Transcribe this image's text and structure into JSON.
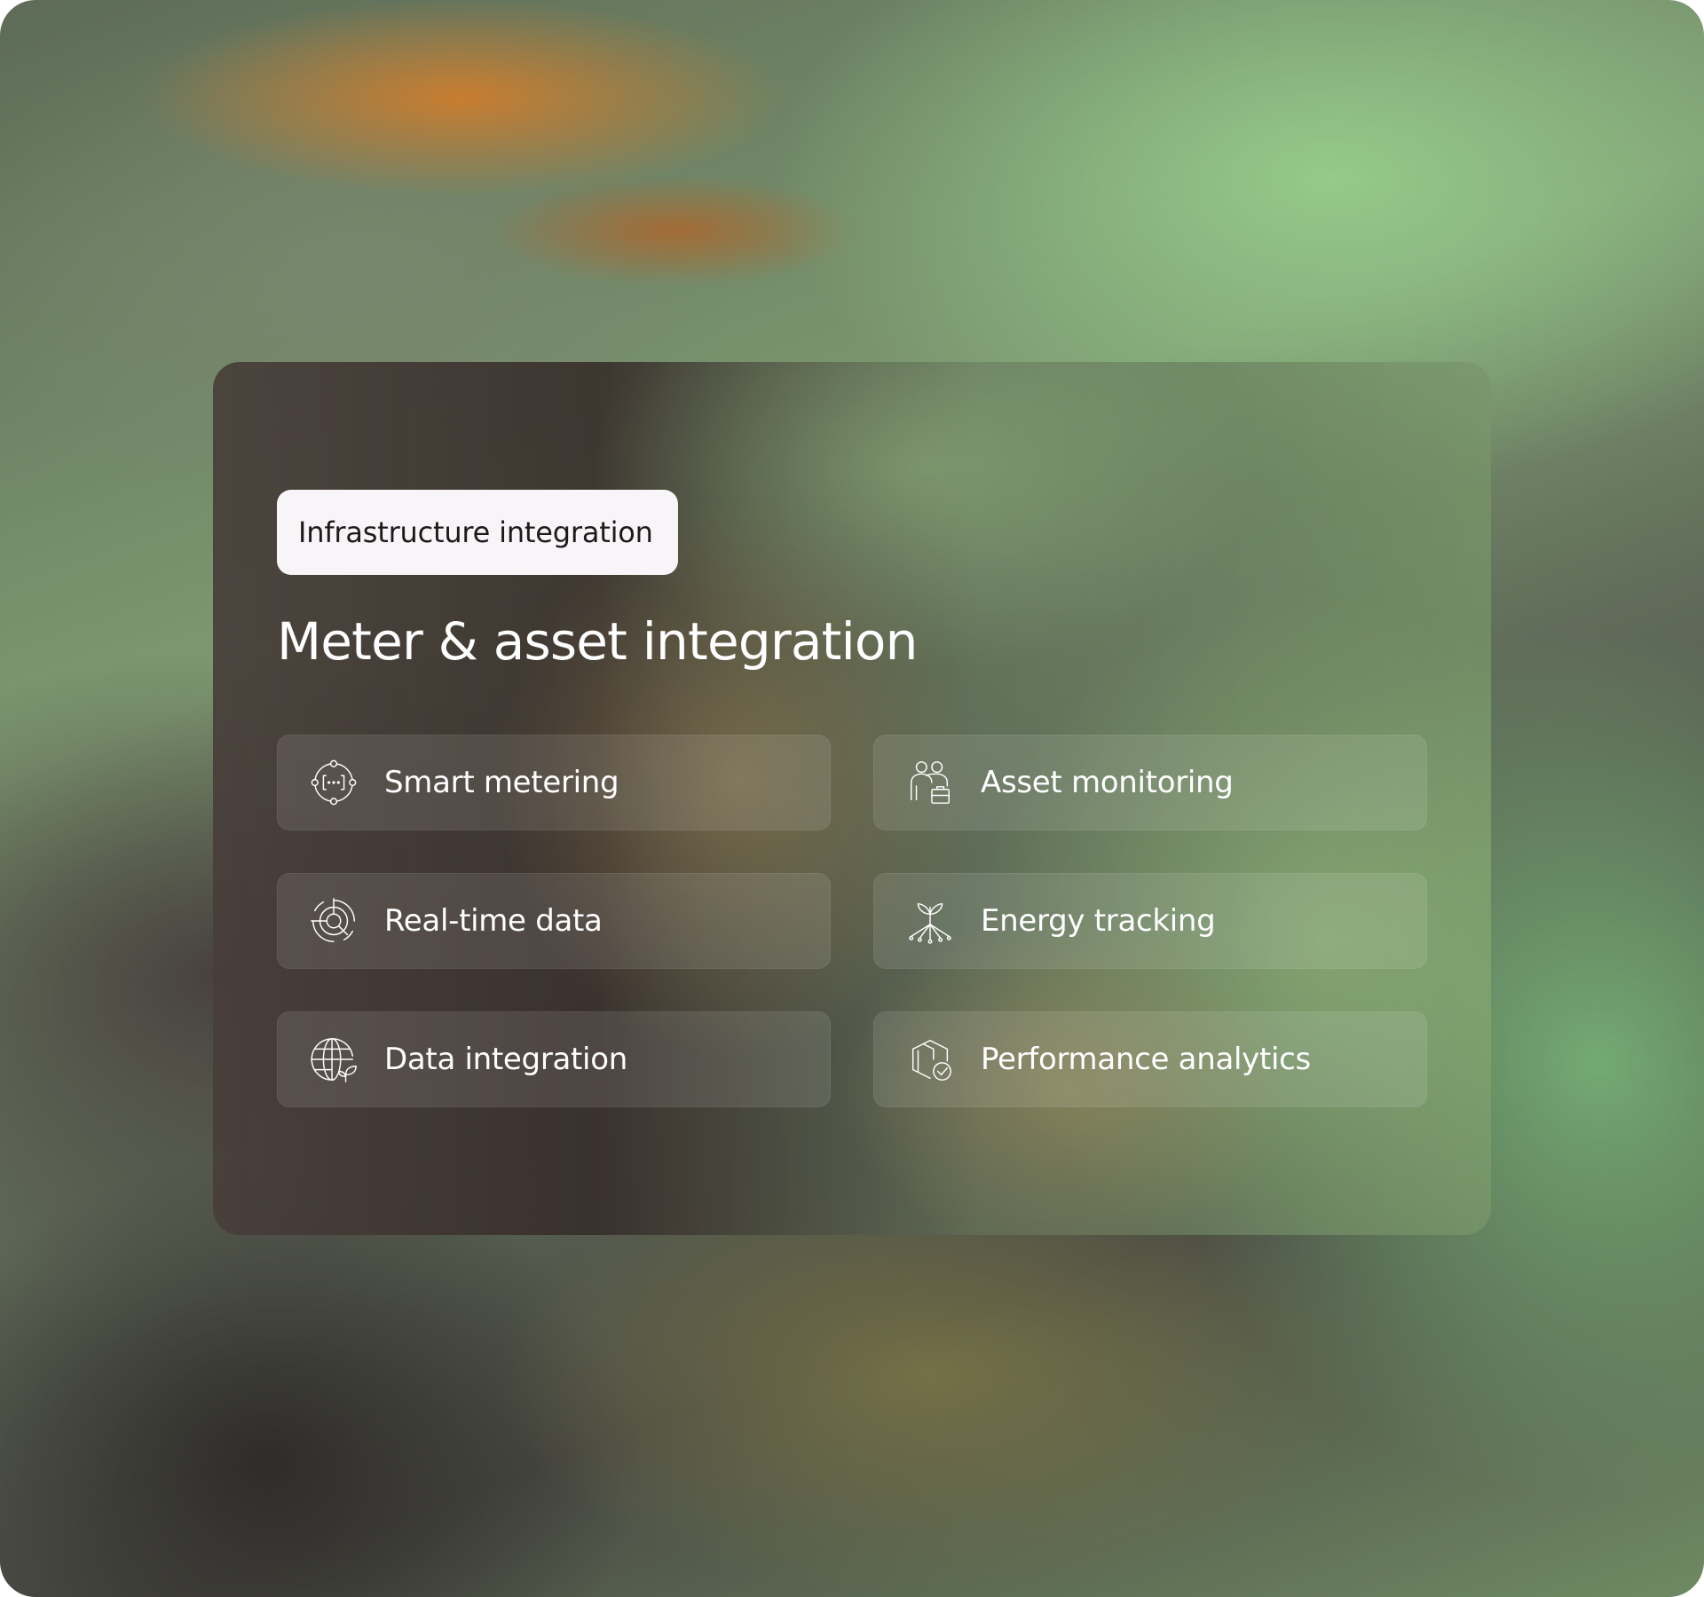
{
  "badge": {
    "label": "Infrastructure integration"
  },
  "heading": "Meter & asset integration",
  "features": [
    {
      "label": "Smart metering",
      "icon": "smart-meter-icon"
    },
    {
      "label": "Asset monitoring",
      "icon": "team-briefcase-icon"
    },
    {
      "label": "Real-time data",
      "icon": "radar-target-icon"
    },
    {
      "label": "Energy tracking",
      "icon": "sprout-network-icon"
    },
    {
      "label": "Data integration",
      "icon": "globe-leaf-icon"
    },
    {
      "label": "Performance analytics",
      "icon": "box-check-icon"
    }
  ]
}
